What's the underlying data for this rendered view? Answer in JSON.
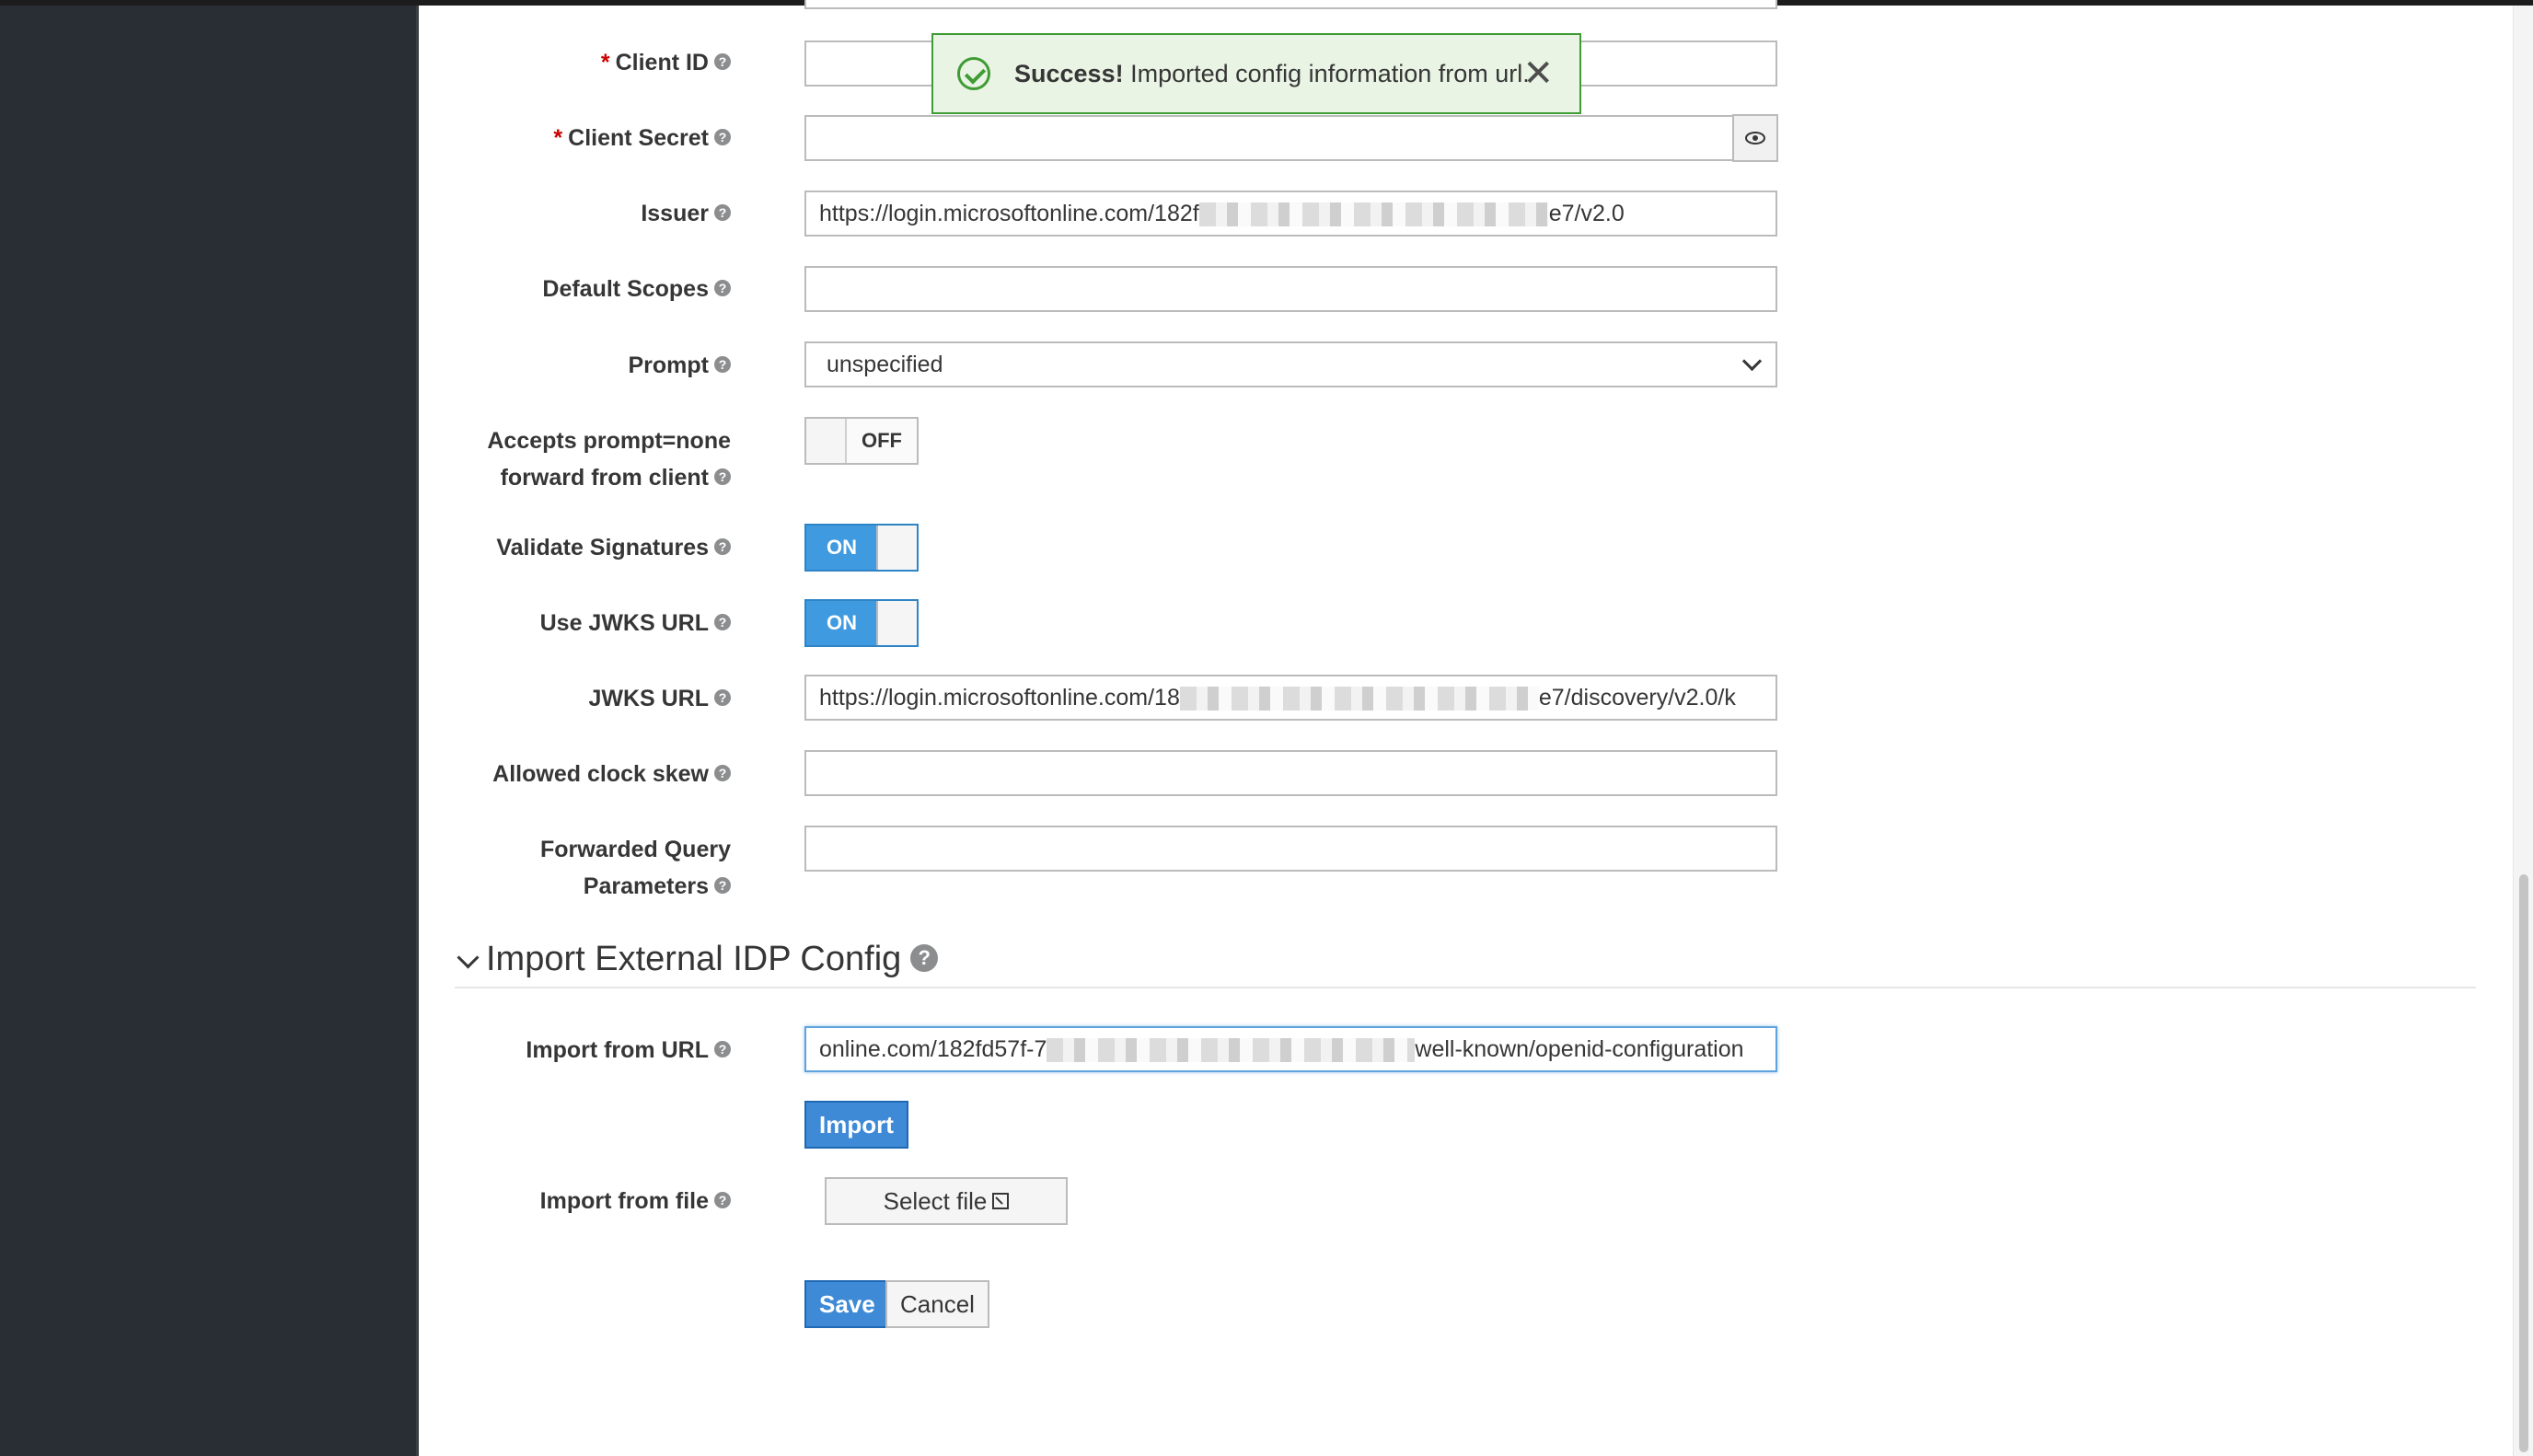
{
  "form": {
    "client_id": {
      "label": "Client ID",
      "required_mark": "*",
      "value": ""
    },
    "client_secret": {
      "label": "Client Secret",
      "required_mark": "*",
      "value": ""
    },
    "issuer": {
      "label": "Issuer",
      "value_prefix": "https://login.microsoftonline.com/182f",
      "value_suffix": "e7/v2.0"
    },
    "default_scopes": {
      "label": "Default Scopes",
      "value": ""
    },
    "prompt": {
      "label": "Prompt",
      "selected": "unspecified"
    },
    "accepts_prompt_none": {
      "label_line1": "Accepts prompt=none",
      "label_line2": "forward from client",
      "state": "OFF"
    },
    "validate_signatures": {
      "label": "Validate Signatures",
      "state": "ON"
    },
    "use_jwks_url": {
      "label": "Use JWKS URL",
      "state": "ON"
    },
    "jwks_url": {
      "label": "JWKS URL",
      "value_prefix": "https://login.microsoftonline.com/18",
      "value_suffix": "e7/discovery/v2.0/k"
    },
    "allowed_clock_skew": {
      "label": "Allowed clock skew",
      "value": ""
    },
    "forwarded_query_parameters": {
      "label_line1": "Forwarded Query",
      "label_line2": "Parameters",
      "value": ""
    }
  },
  "import_section": {
    "title": "Import External IDP Config",
    "import_from_url": {
      "label": "Import from URL",
      "value_prefix": "online.com/182fd57f-7",
      "value_suffix": "well-known/openid-configuration"
    },
    "import_button": "Import",
    "import_from_file": {
      "label": "Import from file",
      "button": "Select file"
    }
  },
  "actions": {
    "save": "Save",
    "cancel": "Cancel"
  },
  "toast": {
    "strong": "Success!",
    "message": " Imported config information from url.",
    "close": "✕"
  },
  "icons": {
    "help": "?",
    "eye": "eye-icon",
    "check": "check-circle-icon",
    "close": "close-icon",
    "chevron": "chevron-down-icon",
    "external": "external-link-icon"
  },
  "colors": {
    "primary": "#3f8ad6",
    "success": "#3f9c35",
    "sidebar": "#292e34"
  }
}
